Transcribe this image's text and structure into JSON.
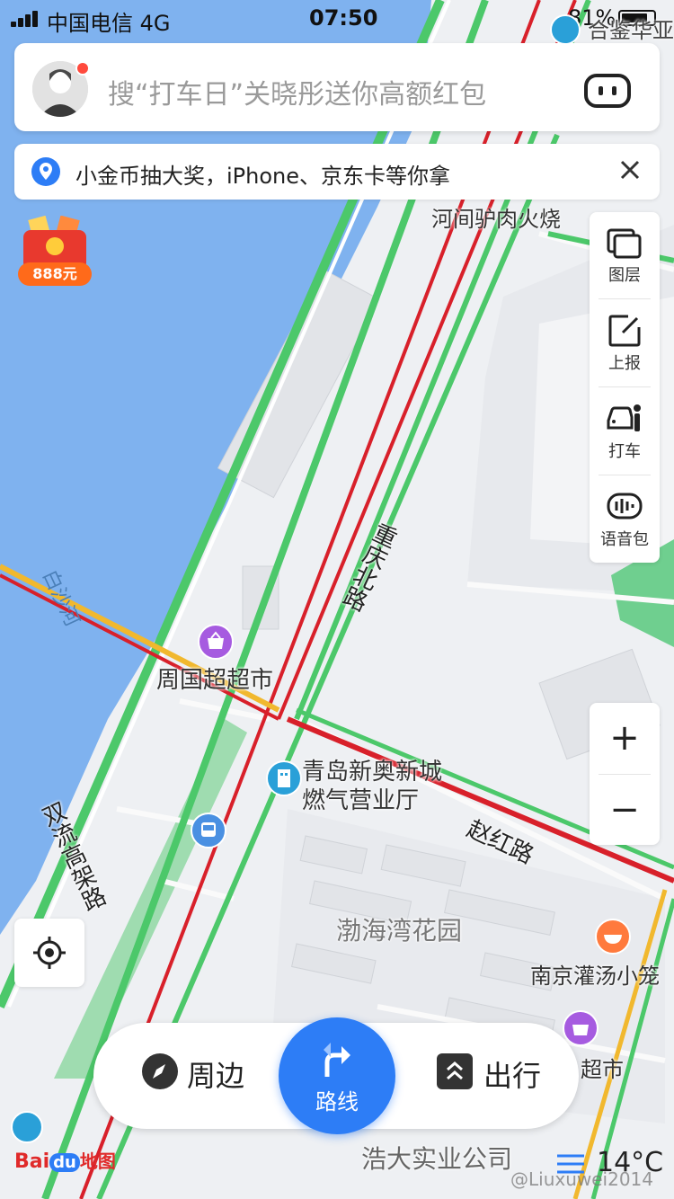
{
  "status_bar": {
    "carrier": "中国电信  4G",
    "time": "07:50",
    "battery": "81%"
  },
  "search": {
    "placeholder": "搜“打车日”关晓彤送你高额红包"
  },
  "notice": {
    "text": "小金币抽大奖，iPhone、京东卡等你拿"
  },
  "promo": {
    "amount": "888元"
  },
  "tools": [
    {
      "label": "图层",
      "icon": "layers-icon"
    },
    {
      "label": "上报",
      "icon": "report-icon"
    },
    {
      "label": "打车",
      "icon": "taxi-icon"
    },
    {
      "label": "语音包",
      "icon": "voice-pack-icon"
    }
  ],
  "zoom": {
    "in": "+",
    "out": "−"
  },
  "map": {
    "labels": {
      "top_partial": "合鉴华亚",
      "hejian": "河间驴肉火烧",
      "river": "白沙河",
      "chongqing_road": "重庆北路",
      "zhouguo": "周国超超市",
      "qingdao_line1": "青岛新奥新城",
      "qingdao_line2": "燃气营业厅",
      "zhaohong_road": "赵红路",
      "shuangliu": "双流高架路",
      "bohai": "渤海湾花园",
      "nanjing": "南京灌汤小笼",
      "supermarket": "超市",
      "haoda": "浩大实业公司"
    }
  },
  "bottom_nav": {
    "nearby": "周边",
    "route": "路线",
    "travel": "出行"
  },
  "brand": {
    "bai": "Bai",
    "du": "du",
    "ditu": "地图"
  },
  "weather": {
    "temp": "14°C"
  },
  "watermark": "@Liuxuwei2014",
  "colors": {
    "accent": "#2d7df6",
    "water": "#7fb2ef",
    "road_green": "#4cc86a",
    "road_red": "#d8202a",
    "road_yellow": "#f1b82e"
  }
}
